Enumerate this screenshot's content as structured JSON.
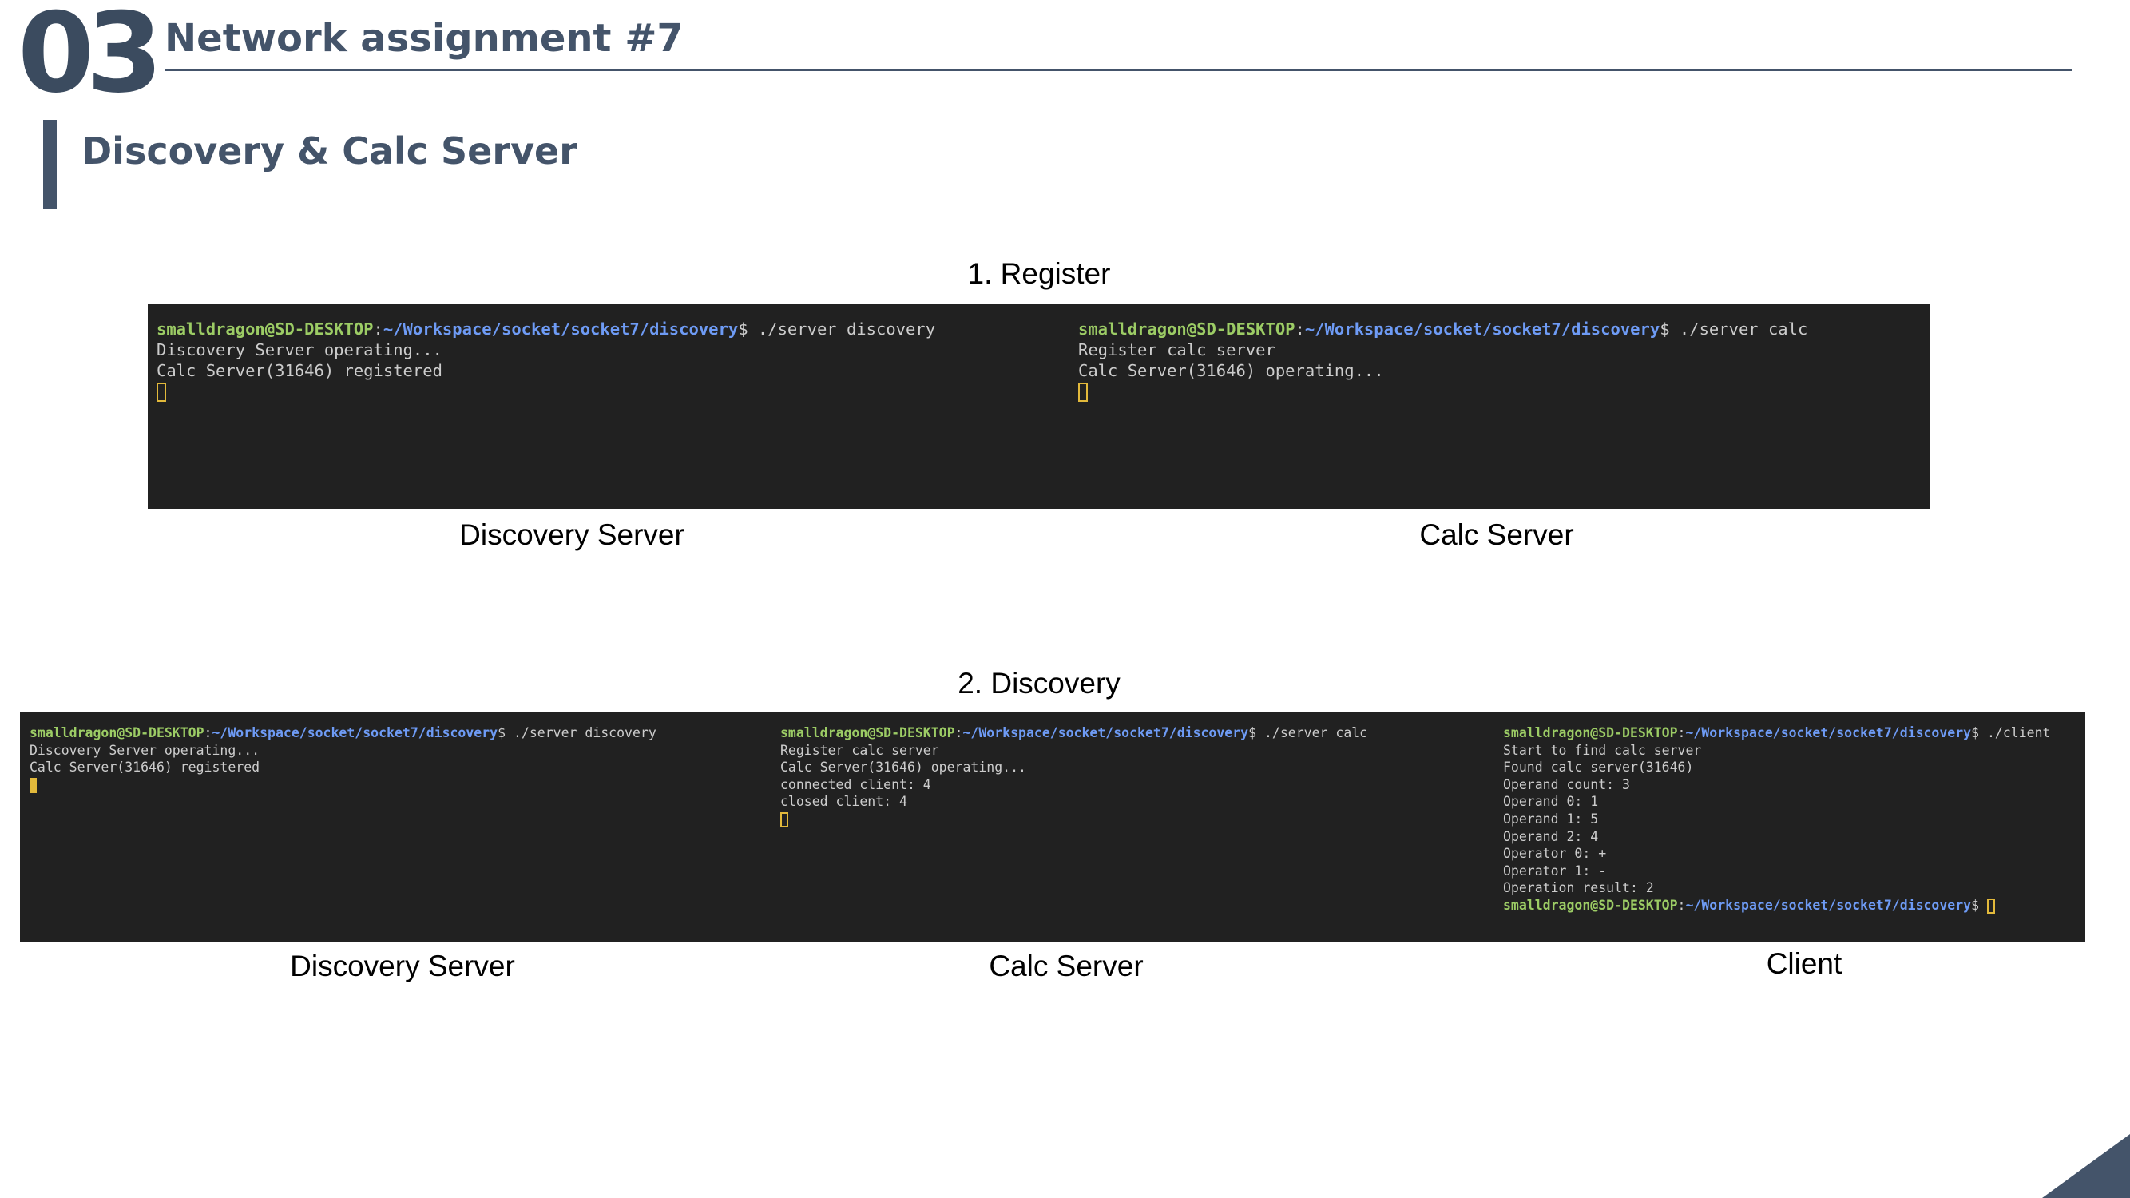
{
  "header": {
    "section_number": "03",
    "title": "Network assignment #7",
    "subtitle": "Discovery & Calc Server"
  },
  "colors": {
    "heading": "#44546a",
    "terminal_bg": "#212121",
    "prompt_user": "#9ccc65",
    "prompt_path": "#6e9bf5",
    "terminal_text": "#cccccc",
    "cursor": "#e2b93b"
  },
  "step1": {
    "label": "1. Register",
    "discovery": {
      "caption": "Discovery Server",
      "prompt_user": "smalldragon@SD-DESKTOP",
      "prompt_path": "~/Workspace/socket/socket7/discovery",
      "command": "$ ./server discovery",
      "output": [
        "Discovery Server operating...",
        "Calc Server(31646) registered"
      ]
    },
    "calc": {
      "caption": "Calc Server",
      "prompt_user": "smalldragon@SD-DESKTOP",
      "prompt_path": "~/Workspace/socket/socket7/discovery",
      "command": "$ ./server calc",
      "output": [
        "Register calc server",
        "Calc Server(31646) operating..."
      ]
    }
  },
  "step2": {
    "label": "2.  Discovery",
    "discovery": {
      "caption": "Discovery Server",
      "prompt_user": "smalldragon@SD-DESKTOP",
      "prompt_path": "~/Workspace/socket/socket7/discovery",
      "command": "$ ./server discovery",
      "output": [
        "Discovery Server operating...",
        "Calc Server(31646) registered"
      ]
    },
    "calc": {
      "caption": "Calc Server",
      "prompt_user": "smalldragon@SD-DESKTOP",
      "prompt_path": "~/Workspace/socket/socket7/discovery",
      "command": "$ ./server calc",
      "output": [
        "Register calc server",
        "Calc Server(31646) operating...",
        "connected client: 4",
        "closed client: 4"
      ]
    },
    "client": {
      "caption": "Client",
      "prompt_user": "smalldragon@SD-DESKTOP",
      "prompt_path": "~/Workspace/socket/socket7/discovery",
      "command": "$ ./client",
      "output": [
        "Start to find calc server",
        "Found calc server(31646)",
        "Operand count: 3",
        "Operand 0: 1",
        "Operand 1: 5",
        "Operand 2: 4",
        "Operator 0: +",
        "Operator 1: -",
        "Operation result: 2"
      ],
      "final_prompt_suffix": "$ "
    }
  }
}
